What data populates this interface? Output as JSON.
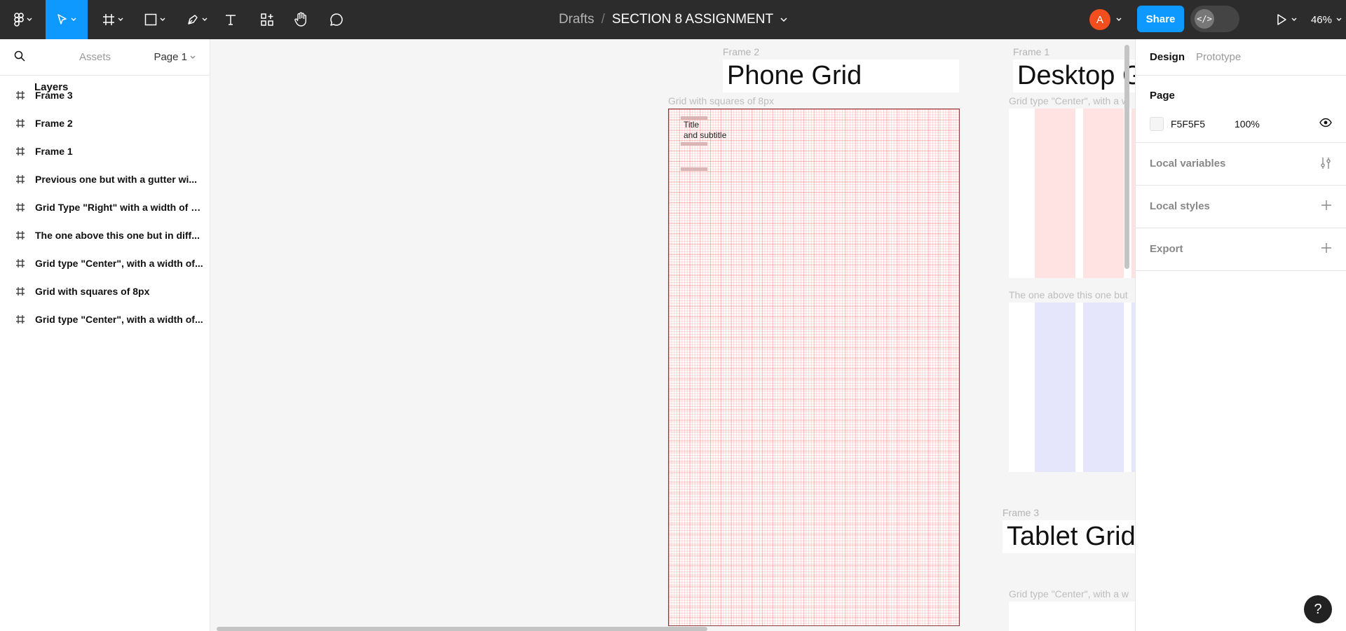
{
  "toolbar": {
    "breadcrumb_root": "Drafts",
    "breadcrumb_separator": "/",
    "file_name": "SECTION 8 ASSIGNMENT",
    "avatar_initial": "A",
    "share_label": "Share",
    "zoom_label": "46%"
  },
  "left_panel": {
    "tab_layers": "Layers",
    "tab_assets": "Assets",
    "page_selector": "Page 1",
    "layers": [
      "Frame 3",
      "Frame 2",
      "Frame 1",
      "Previous one but with a gutter wi...",
      "Grid Type \"Right\" with a width of 1...",
      "The one above this one but in diff...",
      "Grid type \"Center\", with a width of...",
      "Grid with squares of 8px",
      "Grid type \"Center\", with a width of..."
    ]
  },
  "canvas": {
    "frame2_label": "Frame 2",
    "frame2_title": "Phone Grid",
    "frame1_label": "Frame 1",
    "frame1_title": "Desktop G",
    "frame3_label": "Frame 3",
    "frame3_title": "Tablet Grid",
    "phone_grid_caption": "Grid with squares of 8px",
    "phone_grid_title": "Title",
    "phone_grid_subtitle": "and subtitle",
    "desktop_center_caption": "Grid type \"Center\", with a w",
    "desktop_variant_caption": "The one above this one but",
    "tablet_center_caption": "Grid type \"Center\", with a w",
    "colors": {
      "canvas_bg": "#f5f5f5",
      "red_columns": "#ffe3e3",
      "blue_columns": "#e5e5fb",
      "grid_line": "#ffcccc"
    }
  },
  "right_panel": {
    "tab_design": "Design",
    "tab_prototype": "Prototype",
    "page_heading": "Page",
    "page_color_hex": "F5F5F5",
    "page_color_opacity": "100%",
    "local_variables": "Local variables",
    "local_styles": "Local styles",
    "export": "Export"
  },
  "help_label": "?"
}
